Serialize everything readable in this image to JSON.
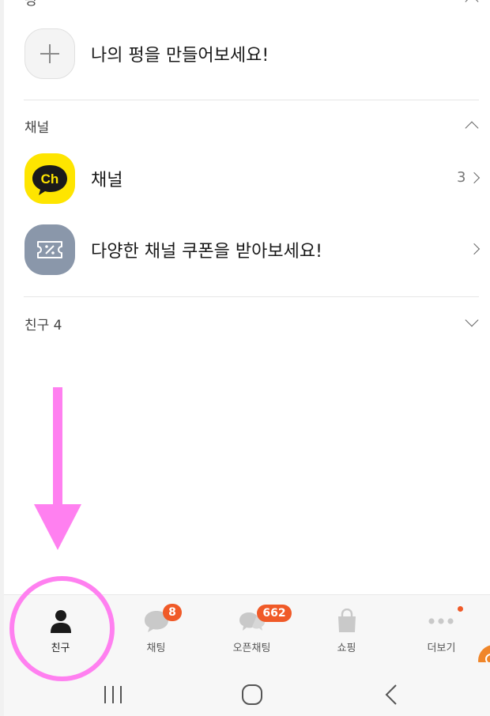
{
  "top_section": {
    "header_partial": "펑",
    "create_prompt": "나의 펑을 만들어보세요!"
  },
  "channel_section": {
    "header": "채널",
    "channel_row": {
      "title": "채널",
      "count": "3",
      "logo_text": "Ch"
    },
    "coupon_row": {
      "title": "다양한 채널 쿠폰을 받아보세요!"
    }
  },
  "friends_section": {
    "header": "친구 4"
  },
  "tabbar": {
    "tabs": [
      {
        "label": "친구",
        "icon": "person-icon",
        "active": true
      },
      {
        "label": "채팅",
        "icon": "chat-bubble-icon",
        "badge": "8"
      },
      {
        "label": "오픈채팅",
        "icon": "open-chat-icon",
        "badge": "662"
      },
      {
        "label": "쇼핑",
        "icon": "shopping-bag-icon"
      },
      {
        "label": "더보기",
        "icon": "more-dots-icon",
        "dot": true
      }
    ]
  },
  "colors": {
    "accent_yellow": "#fee500",
    "badge_orange": "#f05a28",
    "annotation_pink": "#ff80f0",
    "coupon_gray": "#8a97aa"
  }
}
